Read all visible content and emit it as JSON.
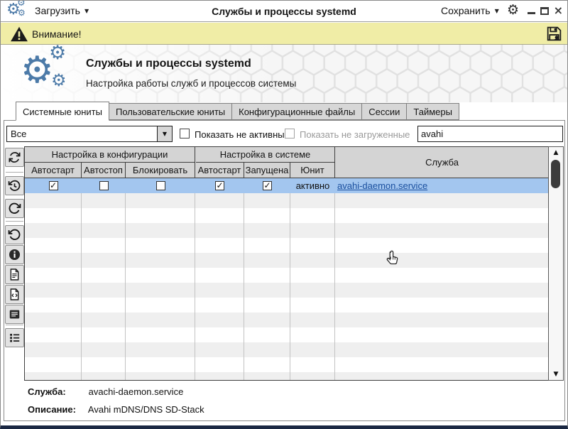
{
  "titlebar": {
    "load_label": "Загрузить",
    "title": "Службы и процессы systemd",
    "save_label": "Сохранить"
  },
  "warning": {
    "text": "Внимание!"
  },
  "header": {
    "title": "Службы и процессы systemd",
    "subtitle": "Настройка работы служб и процессов системы"
  },
  "tabs": [
    {
      "label": "Системные юниты",
      "active": true
    },
    {
      "label": "Пользовательские юниты",
      "active": false
    },
    {
      "label": "Конфигурационные файлы",
      "active": false
    },
    {
      "label": "Сессии",
      "active": false
    },
    {
      "label": "Таймеры",
      "active": false
    }
  ],
  "filters": {
    "scope_value": "Все",
    "show_inactive_label": "Показать не активные",
    "show_inactive_checked": false,
    "show_unloaded_label": "Показать не загруженные",
    "show_unloaded_checked": false,
    "search_value": "avahi"
  },
  "toolbar": {
    "icons": [
      "refresh-icon",
      "history-restore-icon",
      "redo-icon",
      "undo-icon",
      "info-icon",
      "file-icon",
      "file-code-icon",
      "journal-icon",
      "unit-list-icon"
    ]
  },
  "table": {
    "group_headers": {
      "config": "Настройка в конфигурации",
      "system": "Настройка в системе",
      "service": "Служба"
    },
    "columns": [
      "Автостарт",
      "Автостоп",
      "Блокировать",
      "Автостарт",
      "Запущена",
      "Юнит"
    ],
    "rows": [
      {
        "config_autostart": true,
        "config_autostop": false,
        "config_block": false,
        "system_autostart": true,
        "system_running": true,
        "unit_state": "активно",
        "service": "avahi-daemon.service"
      }
    ]
  },
  "details": {
    "service_label": "Служба:",
    "service_value": "avachi-daemon.service",
    "description_label": "Описание:",
    "description_value": "Avahi mDNS/DNS SD-Stack"
  },
  "colors": {
    "accent_blue": "#4c7aa8",
    "selection_blue": "#a3c6ef",
    "link_blue": "#1a4f9e",
    "warning_yellow": "#f0eda6",
    "window_bottom_navy": "#1a2742"
  }
}
